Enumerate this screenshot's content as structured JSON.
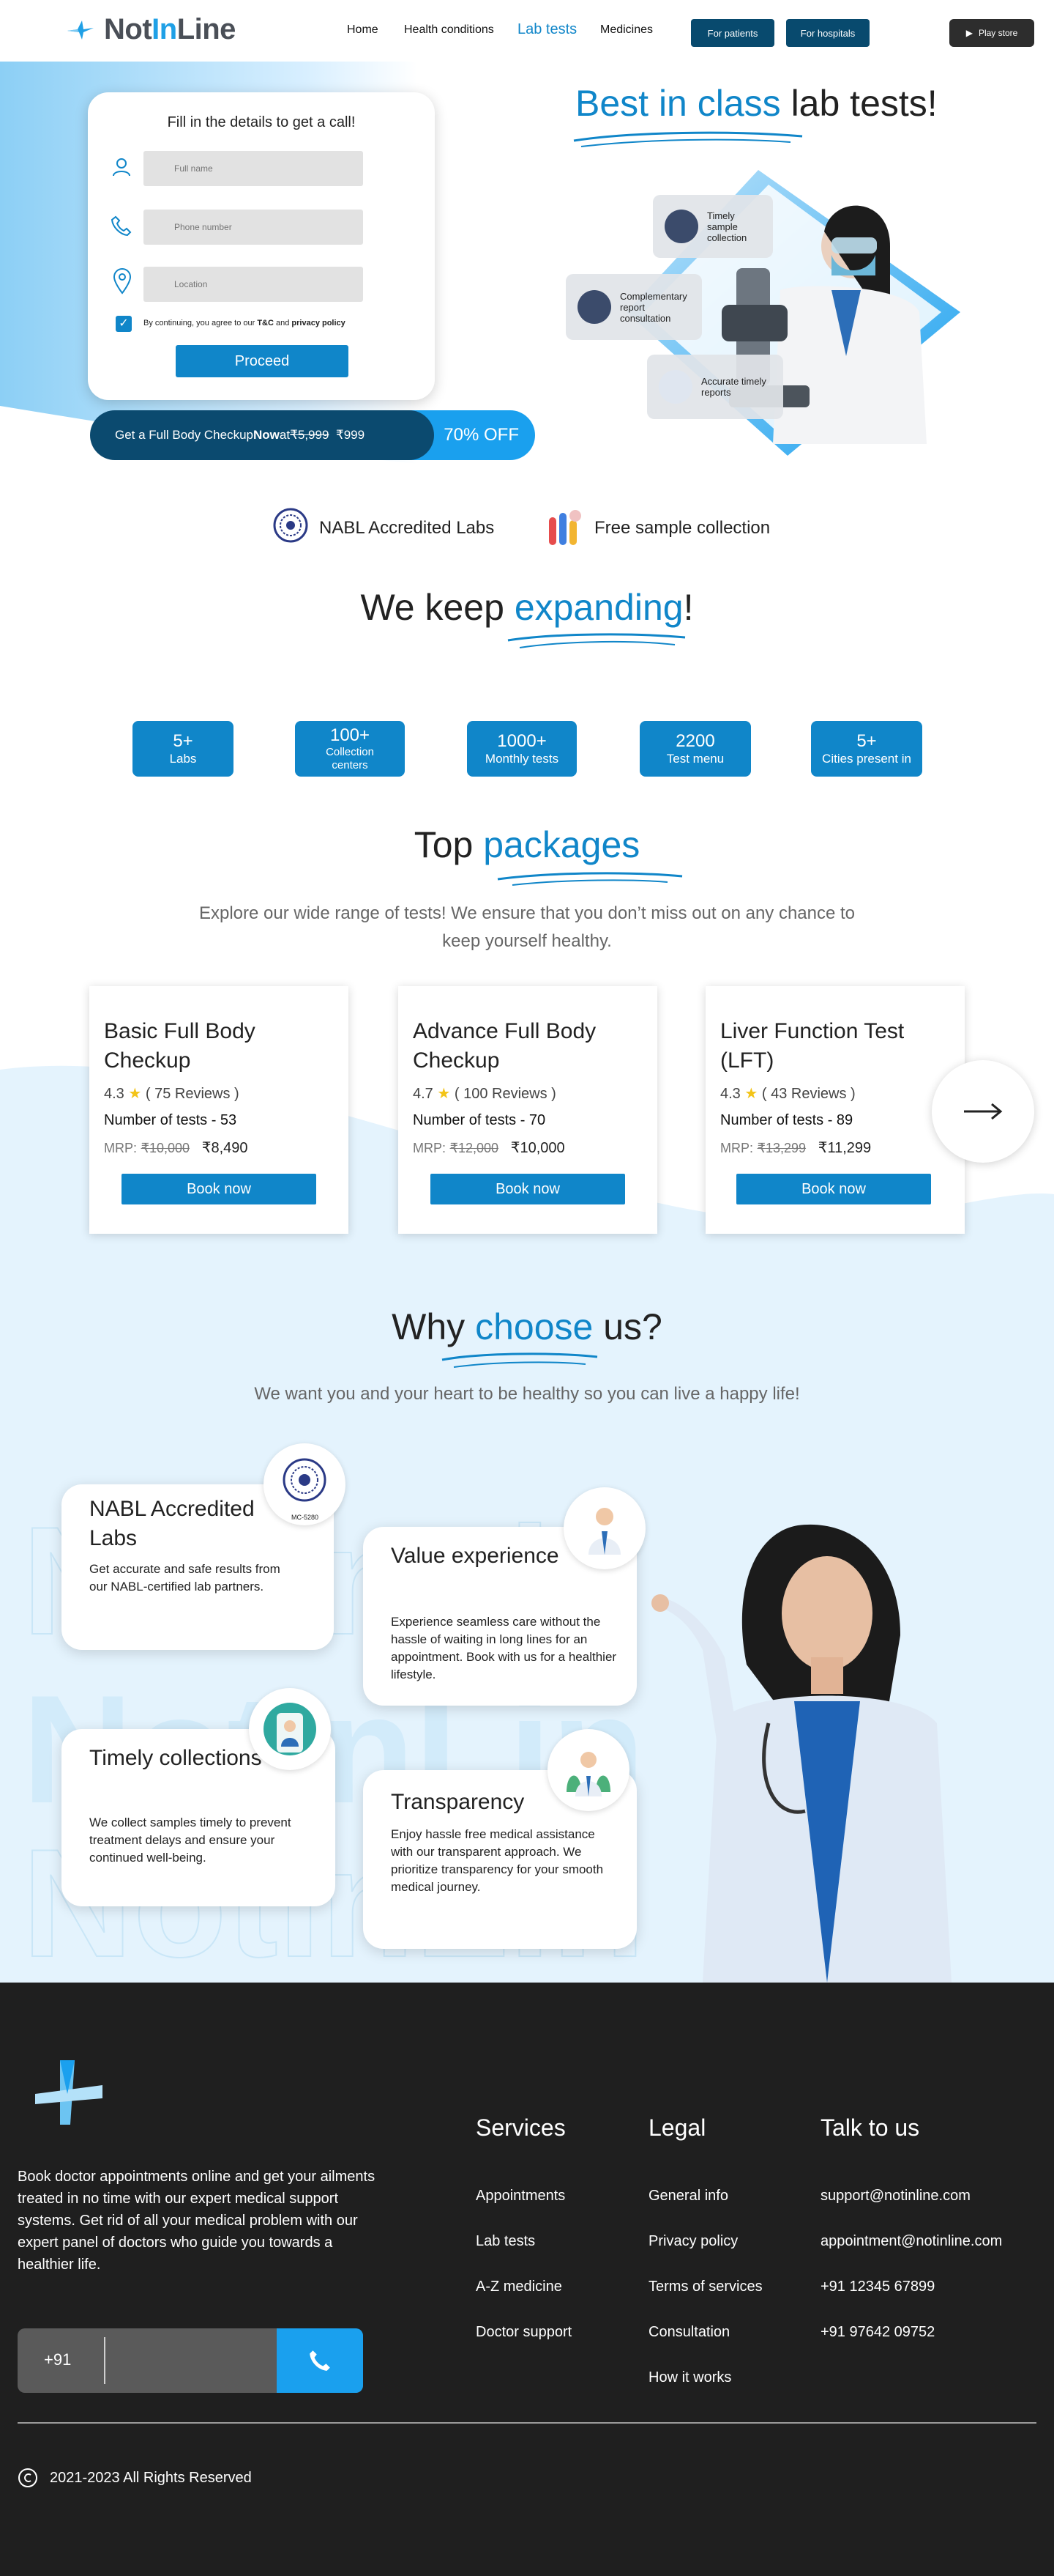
{
  "header": {
    "logo_prefix": "Not",
    "logo_in": "In",
    "logo_suffix": "Line",
    "nav": [
      "Home",
      "Health conditions",
      "Lab tests",
      "Medicines"
    ],
    "btn_patients": "For patients",
    "btn_hospitals": "For hospitals",
    "btn_playstore": "Play store"
  },
  "form": {
    "title": "Fill in the details to get a call!",
    "fullname_placeholder": "Full name",
    "phone_placeholder": "Phone number",
    "location_placeholder": "Location",
    "terms_prefix": "By continuing, you agree to our ",
    "terms_tc": "T&C",
    "terms_and": " and ",
    "terms_privacy": "privacy policy",
    "proceed": "Proceed"
  },
  "offer": {
    "text": "Get a Full Body Checkup ",
    "now": "Now",
    "at": " at ",
    "old_price": "₹5,999",
    "new_price": "₹999",
    "discount": "70% OFF"
  },
  "hero": {
    "title_accent": "Best in class",
    "title_rest": " lab tests!",
    "features": [
      "Timely sample collection",
      "Complementary report consultation",
      "Accurate timely reports"
    ]
  },
  "badges": {
    "nabl": "NABL Accredited Labs",
    "sample": "Free sample collection"
  },
  "expanding": {
    "title_pre": "We keep ",
    "title_accent": "expanding",
    "title_post": "!"
  },
  "stats": [
    {
      "num": "5+",
      "label": "Labs"
    },
    {
      "num": "100+",
      "label": "Collection centers"
    },
    {
      "num": "1000+",
      "label": "Monthly tests"
    },
    {
      "num": "2200",
      "label": "Test menu"
    },
    {
      "num": "5+",
      "label": "Cities present in"
    }
  ],
  "packages": {
    "title_pre": "Top ",
    "title_accent": "packages",
    "subtitle": "Explore our wide range of tests! We ensure that you don’t miss out on any chance to keep yourself healthy.",
    "items": [
      {
        "name": "Basic Full Body Checkup",
        "rating": "4.3",
        "reviews": "( 75 Reviews )",
        "tests": "Number of tests - 53",
        "mrp_label": "MRP:",
        "mrp": "₹10,000",
        "price": "₹8,490",
        "cta": "Book now"
      },
      {
        "name": "Advance Full Body Checkup",
        "rating": "4.7",
        "reviews": "( 100 Reviews )",
        "tests": "Number of tests - 70",
        "mrp_label": "MRP:",
        "mrp": "₹12,000",
        "price": "₹10,000",
        "cta": "Book now"
      },
      {
        "name": "Liver Function Test (LFT)",
        "rating": "4.3",
        "reviews": "( 43 Reviews )",
        "tests": "Number of tests - 89",
        "mrp_label": "MRP:",
        "mrp": "₹13,299",
        "price": "₹11,299",
        "cta": "Book now"
      }
    ]
  },
  "why": {
    "title_pre": "Why ",
    "title_accent": "choose",
    "title_post": " us?",
    "subtitle": "We want you and your heart to be healthy so you can live a happy life!",
    "nabl_badge": "MC-5280",
    "cards": [
      {
        "title": "NABL Accredited Labs",
        "desc": "Get accurate and safe results from our NABL-certified lab partners."
      },
      {
        "title": "Value experience",
        "desc": "Experience seamless care without the hassle of waiting in long lines for an appointment. Book with us for a healthier lifestyle."
      },
      {
        "title": "Timely collections",
        "desc": "We collect samples timely to prevent treatment delays and ensure your continued well-being."
      },
      {
        "title": "Transparency",
        "desc": " Enjoy hassle free medical assistance with our transparent approach. We prioritize transparency for your smooth medical journey."
      }
    ]
  },
  "footer": {
    "description": "Book doctor appointments online and get your ailments treated in no time with our expert medical support systems. Get rid of all your medical problem with our expert panel of doctors who guide you towards a healthier life.",
    "phone_code": "+91",
    "services_title": "Services",
    "services": [
      "Appointments",
      "Lab tests",
      "A-Z medicine",
      "Doctor support"
    ],
    "legal_title": "Legal",
    "legal": [
      "General info",
      "Privacy policy",
      "Terms of services",
      "Consultation",
      "How it works"
    ],
    "talk_title": "Talk to us",
    "contacts": [
      "support@notinline.com",
      "appointment@notinline.com",
      "+91 12345 67899",
      "+91 97642 09752"
    ],
    "copyright": "2021-2023 All Rights Reserved"
  }
}
